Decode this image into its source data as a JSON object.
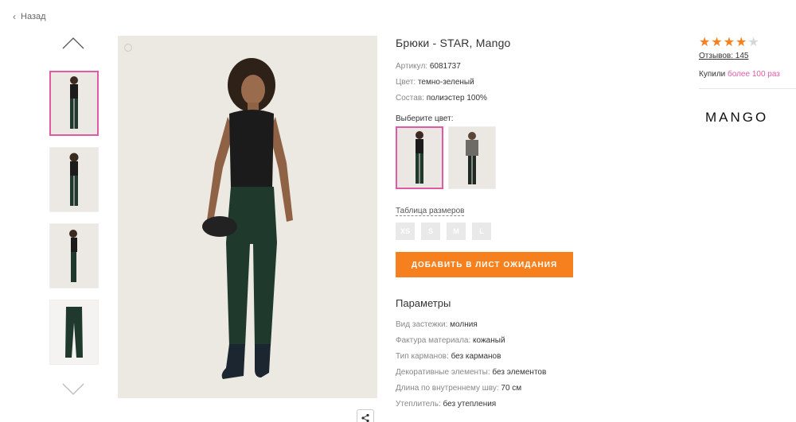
{
  "nav": {
    "back_label": "Назад"
  },
  "product": {
    "title": "Брюки - STAR, Mango",
    "article_key": "Артикул:",
    "article_value": "6081737",
    "color_key": "Цвет:",
    "color_value": "темно-зеленый",
    "composition_key": "Состав:",
    "composition_value": "полиэстер 100%",
    "choose_color_label": "Выберите цвет:",
    "size_table_label": "Таблица размеров",
    "sizes": [
      "XS",
      "S",
      "M",
      "L"
    ],
    "cta_label": "ДОБАВИТЬ В ЛИСТ ОЖИДАНИЯ"
  },
  "params": {
    "title": "Параметры",
    "items": [
      {
        "k": "Вид застежки:",
        "v": "молния"
      },
      {
        "k": "Фактура материала:",
        "v": "кожаный"
      },
      {
        "k": "Тип карманов:",
        "v": "без карманов"
      },
      {
        "k": "Декоративные элементы:",
        "v": "без элементов"
      },
      {
        "k": "Длина по внутреннему шву:",
        "v": "70 см"
      },
      {
        "k": "Утеплитель:",
        "v": "без утепления"
      }
    ]
  },
  "rating": {
    "stars": 4,
    "max_stars": 5,
    "reviews_label": "Отзывов: 145",
    "bought_prefix": "Купили",
    "bought_highlight": "более 100 раз"
  },
  "brand": {
    "logo_text": "MANGO"
  },
  "colors": {
    "accent": "#f7801e",
    "highlight": "#e05aa6",
    "pants": "#1f3a2c",
    "top": "#1b1b1b",
    "star_filled": "#f7801e",
    "star_empty": "#d6d6d6"
  },
  "icons": [
    "chevron-left-icon",
    "arrow-up-icon",
    "arrow-down-icon",
    "zoom-icon",
    "share-icon",
    "star-icon"
  ]
}
